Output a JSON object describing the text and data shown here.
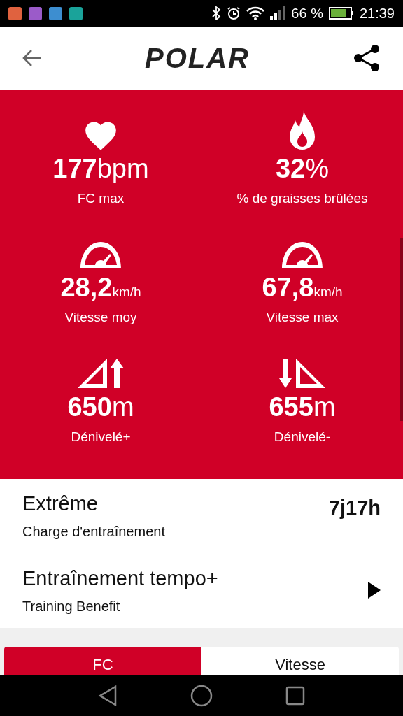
{
  "status_bar": {
    "battery": "66 %",
    "time": "21:39"
  },
  "header": {
    "logo": "POLAR"
  },
  "stats": [
    {
      "kind": "heart",
      "value": "177",
      "unit": "bpm",
      "label": "FC max"
    },
    {
      "kind": "flame",
      "value": "32",
      "unit": "%",
      "label": "% de graisses brûlées"
    },
    {
      "kind": "gauge",
      "value": "28,2",
      "unit": "km/h",
      "label": "Vitesse moy"
    },
    {
      "kind": "gauge",
      "value": "67,8",
      "unit": "km/h",
      "label": "Vitesse max"
    },
    {
      "kind": "ascent",
      "value": "650",
      "unit": "m",
      "label": "Dénivelé+"
    },
    {
      "kind": "descent",
      "value": "655",
      "unit": "m",
      "label": "Dénivelé-"
    }
  ],
  "load": {
    "title": "Extrême",
    "subtitle": "Charge d'entraînement",
    "value": "7j17h"
  },
  "benefit": {
    "title": "Entraînement tempo+",
    "subtitle": "Training Benefit"
  },
  "tabs": [
    {
      "label": "FC",
      "selected": true
    },
    {
      "label": "Vitesse",
      "selected": false
    }
  ]
}
